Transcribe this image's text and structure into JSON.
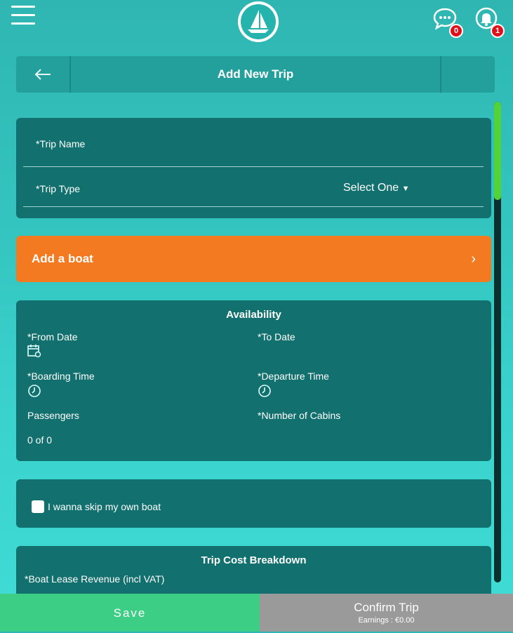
{
  "header": {
    "messages_badge": "0",
    "notifications_badge": "1"
  },
  "titlebar": {
    "title": "Add New Trip"
  },
  "trip_form": {
    "trip_name_label": "*Trip Name",
    "trip_type_label": "*Trip Type",
    "trip_type_value": "Select One"
  },
  "add_boat": {
    "label": "Add a boat"
  },
  "availability": {
    "title": "Availability",
    "from_date_label": "*From Date",
    "to_date_label": "*To Date",
    "boarding_time_label": "*Boarding Time",
    "departure_time_label": "*Departure Time",
    "passengers_label": "Passengers",
    "passengers_value": "0 of 0",
    "cabins_label": "*Number of Cabins"
  },
  "skip_boat": {
    "label": "I wanna skip my own boat"
  },
  "cost_breakdown": {
    "title": "Trip Cost Breakdown",
    "boat_lease_label": "*Boat Lease Revenue (incl VAT)"
  },
  "footer": {
    "save_label": "Save",
    "confirm_label": "Confirm Trip",
    "earnings_label": "Earnings : €0.00"
  },
  "colors": {
    "background": "#34c4bf",
    "card": "#12706f",
    "accent_orange": "#f47a22",
    "save_green": "#3cce84",
    "confirm_gray": "#9a9a9a",
    "badge_red": "#e0101a"
  }
}
